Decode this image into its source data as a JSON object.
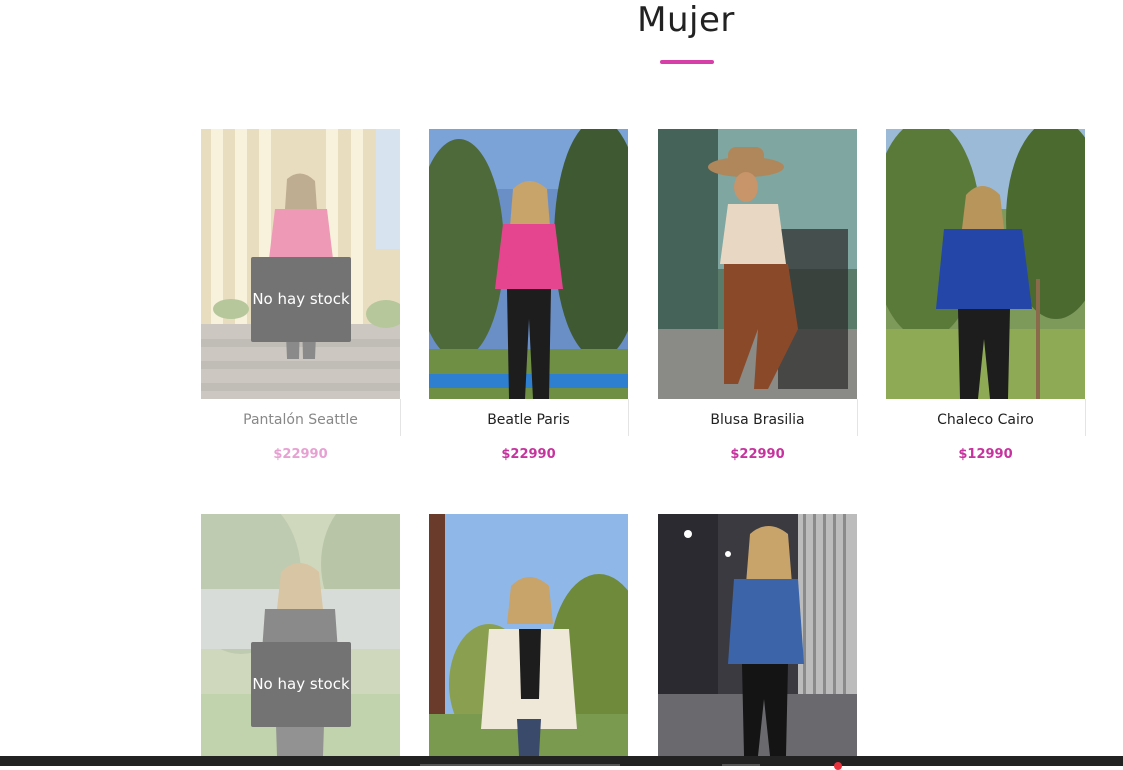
{
  "page": {
    "title": "Mujer",
    "accent": "#d63fa8"
  },
  "products": [
    {
      "name": "Pantalón Seattle",
      "price": "$22990",
      "stock_label": "No hay stock",
      "in_stock": false
    },
    {
      "name": "Beatle Paris",
      "price": "$22990",
      "in_stock": true
    },
    {
      "name": "Blusa Brasilia",
      "price": "$22990",
      "in_stock": true
    },
    {
      "name": "Chaleco Cairo",
      "price": "$12990",
      "in_stock": true
    },
    {
      "stock_label": "No hay stock",
      "in_stock": false
    },
    {
      "in_stock": true
    },
    {
      "in_stock": true
    }
  ]
}
